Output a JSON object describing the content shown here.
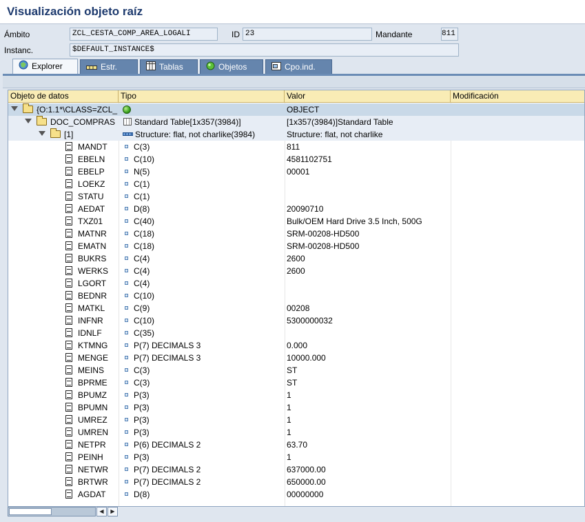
{
  "window": {
    "title": "Visualización objeto raíz"
  },
  "fields": {
    "ambito_label": "Ámbito",
    "ambito_value": "ZCL_CESTA_COMP_AREA_LOGALI",
    "id_label": "ID",
    "id_value": "23",
    "mandante_label": "Mandante",
    "mandante_value": "811",
    "instanc_label": "Instanc.",
    "instanc_value": "$DEFAULT_INSTANCE$"
  },
  "tabs": [
    {
      "label": "Explorer",
      "icon": "explorer-icon"
    },
    {
      "label": "Estr.",
      "icon": "structure-icon"
    },
    {
      "label": "Tablas",
      "icon": "table-icon"
    },
    {
      "label": "Objetos",
      "icon": "object-icon"
    },
    {
      "label": "Cpo.ind.",
      "icon": "field-icon"
    }
  ],
  "tree": {
    "columns": [
      "Objeto de datos",
      "Tipo",
      "Valor",
      "Modificación"
    ],
    "root": {
      "name": "{O:1.1*\\CLASS=ZCL_",
      "type": "",
      "value": "OBJECT"
    },
    "table_node": {
      "name": "DOC_COMPRAS",
      "type": "Standard Table[1x357(3984)]",
      "value": "[1x357(3984)]Standard Table"
    },
    "struct_node": {
      "name": "[1]",
      "type": "Structure: flat, not charlike(3984)",
      "value": "Structure: flat, not charlike"
    },
    "fields": [
      {
        "name": "MANDT",
        "type": "C(3)",
        "value": "811"
      },
      {
        "name": "EBELN",
        "type": "C(10)",
        "value": "4581102751"
      },
      {
        "name": "EBELP",
        "type": "N(5)",
        "value": "00001"
      },
      {
        "name": "LOEKZ",
        "type": "C(1)",
        "value": ""
      },
      {
        "name": "STATU",
        "type": "C(1)",
        "value": ""
      },
      {
        "name": "AEDAT",
        "type": "D(8)",
        "value": "20090710"
      },
      {
        "name": "TXZ01",
        "type": "C(40)",
        "value": "Bulk/OEM Hard Drive 3.5 Inch, 500G"
      },
      {
        "name": "MATNR",
        "type": "C(18)",
        "value": "SRM-00208-HD500"
      },
      {
        "name": "EMATN",
        "type": "C(18)",
        "value": "SRM-00208-HD500"
      },
      {
        "name": "BUKRS",
        "type": "C(4)",
        "value": "2600"
      },
      {
        "name": "WERKS",
        "type": "C(4)",
        "value": "2600"
      },
      {
        "name": "LGORT",
        "type": "C(4)",
        "value": ""
      },
      {
        "name": "BEDNR",
        "type": "C(10)",
        "value": ""
      },
      {
        "name": "MATKL",
        "type": "C(9)",
        "value": "00208"
      },
      {
        "name": "INFNR",
        "type": "C(10)",
        "value": "5300000032"
      },
      {
        "name": "IDNLF",
        "type": "C(35)",
        "value": ""
      },
      {
        "name": "KTMNG",
        "type": "P(7) DECIMALS 3",
        "value": "0.000"
      },
      {
        "name": "MENGE",
        "type": "P(7) DECIMALS 3",
        "value": "10000.000"
      },
      {
        "name": "MEINS",
        "type": "C(3)",
        "value": "ST"
      },
      {
        "name": "BPRME",
        "type": "C(3)",
        "value": "ST"
      },
      {
        "name": "BPUMZ",
        "type": "P(3)",
        "value": "1"
      },
      {
        "name": "BPUMN",
        "type": "P(3)",
        "value": "1"
      },
      {
        "name": "UMREZ",
        "type": "P(3)",
        "value": "1"
      },
      {
        "name": "UMREN",
        "type": "P(3)",
        "value": "1"
      },
      {
        "name": "NETPR",
        "type": "P(6) DECIMALS 2",
        "value": "63.70"
      },
      {
        "name": "PEINH",
        "type": "P(3)",
        "value": "1"
      },
      {
        "name": "NETWR",
        "type": "P(7) DECIMALS 2",
        "value": "637000.00"
      },
      {
        "name": "BRTWR",
        "type": "P(7) DECIMALS 2",
        "value": "650000.00"
      },
      {
        "name": "AGDAT",
        "type": "D(8)",
        "value": "00000000"
      }
    ]
  },
  "colors": {
    "title": "#1d3a6e",
    "tab_bg": "#6585ad",
    "header_bg": "#f9ecb5",
    "selected_row": "#c9d9e8"
  }
}
